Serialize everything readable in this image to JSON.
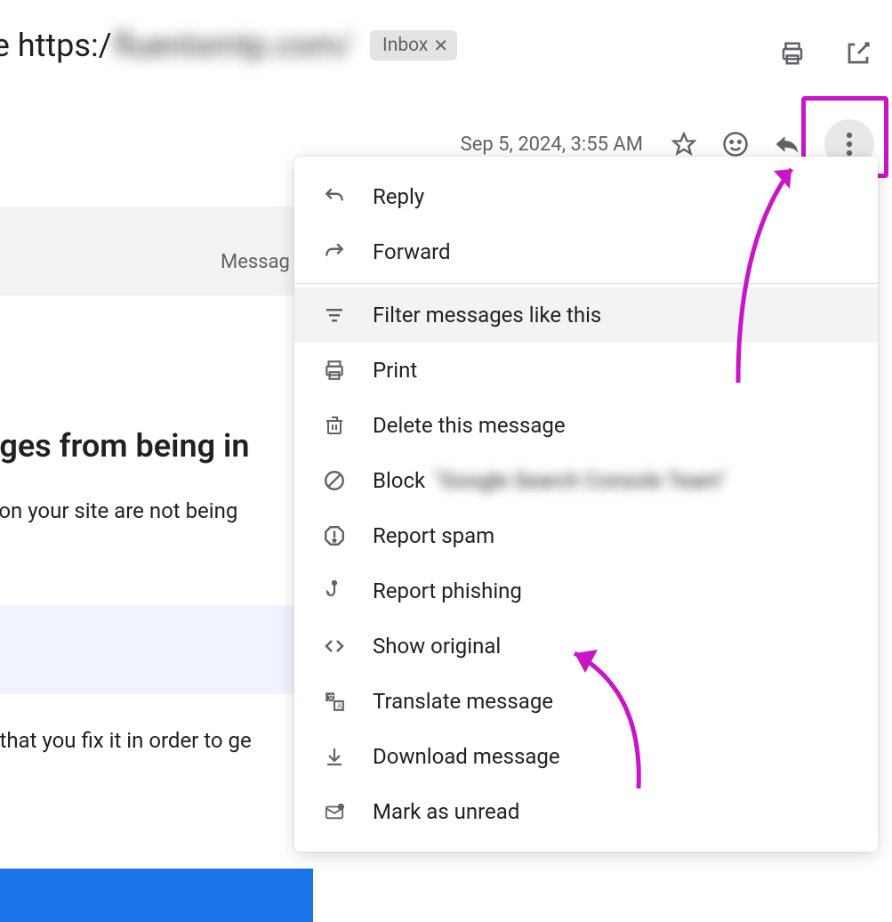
{
  "header": {
    "subject_prefix": "te https:/",
    "subject_blurred": "fluentsmtp.com/",
    "chip_label": "Inbox",
    "timestamp": "Sep 5, 2024, 3:55 AM"
  },
  "bg": {
    "messag": "Messag",
    "e": "e",
    "ages": "ages from being in",
    "site": "s on your site are not being",
    "fix": "d that you fix it in order to ge"
  },
  "menu": {
    "reply": "Reply",
    "forward": "Forward",
    "filter": "Filter messages like this",
    "print": "Print",
    "delete": "Delete this message",
    "block": "Block",
    "block_blur": "\"Google Search Console Team\"",
    "spam": "Report spam",
    "phishing": "Report phishing",
    "show_original": "Show original",
    "translate": "Translate message",
    "download": "Download message",
    "mark_unread": "Mark as unread"
  },
  "annotation": {
    "highlight_color": "#c815c8"
  }
}
